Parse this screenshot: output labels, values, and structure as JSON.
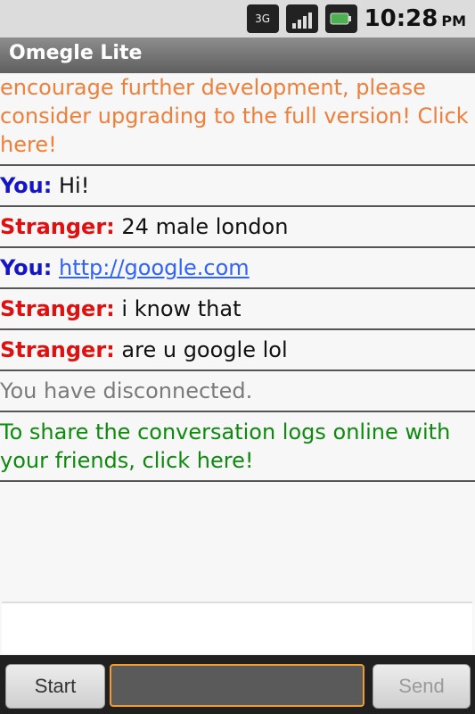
{
  "status_bar": {
    "network_label": "3G",
    "time": "10:28",
    "meridiem": "PM",
    "icons": [
      "network-3g-icon",
      "signal-strength-icon",
      "battery-icon"
    ]
  },
  "app": {
    "title": "Omegle Lite"
  },
  "messages": {
    "notice": "Android. For more features and to encourage further development, please consider upgrading to the full version! Click here!",
    "m1": {
      "speaker": "You:",
      "text": "Hi!"
    },
    "m2": {
      "speaker": "Stranger:",
      "text": "24 male london"
    },
    "m3": {
      "speaker": "You:",
      "text": "http://google.com"
    },
    "m4": {
      "speaker": "Stranger:",
      "text": "i know that"
    },
    "m5": {
      "speaker": "Stranger:",
      "text": "are u google lol"
    },
    "disconnected": "You have disconnected.",
    "share": "To share the conversation logs online with your friends, click here!"
  },
  "controls": {
    "start_label": "Start",
    "send_label": "Send",
    "input_value": ""
  },
  "colors": {
    "notice": "#f07f3a",
    "you": "#1414c8",
    "stranger": "#e01010",
    "link": "#2f62ff",
    "disconnected": "#7a7a7a",
    "share": "#0e8a0e",
    "input_border": "#f29b2f"
  }
}
